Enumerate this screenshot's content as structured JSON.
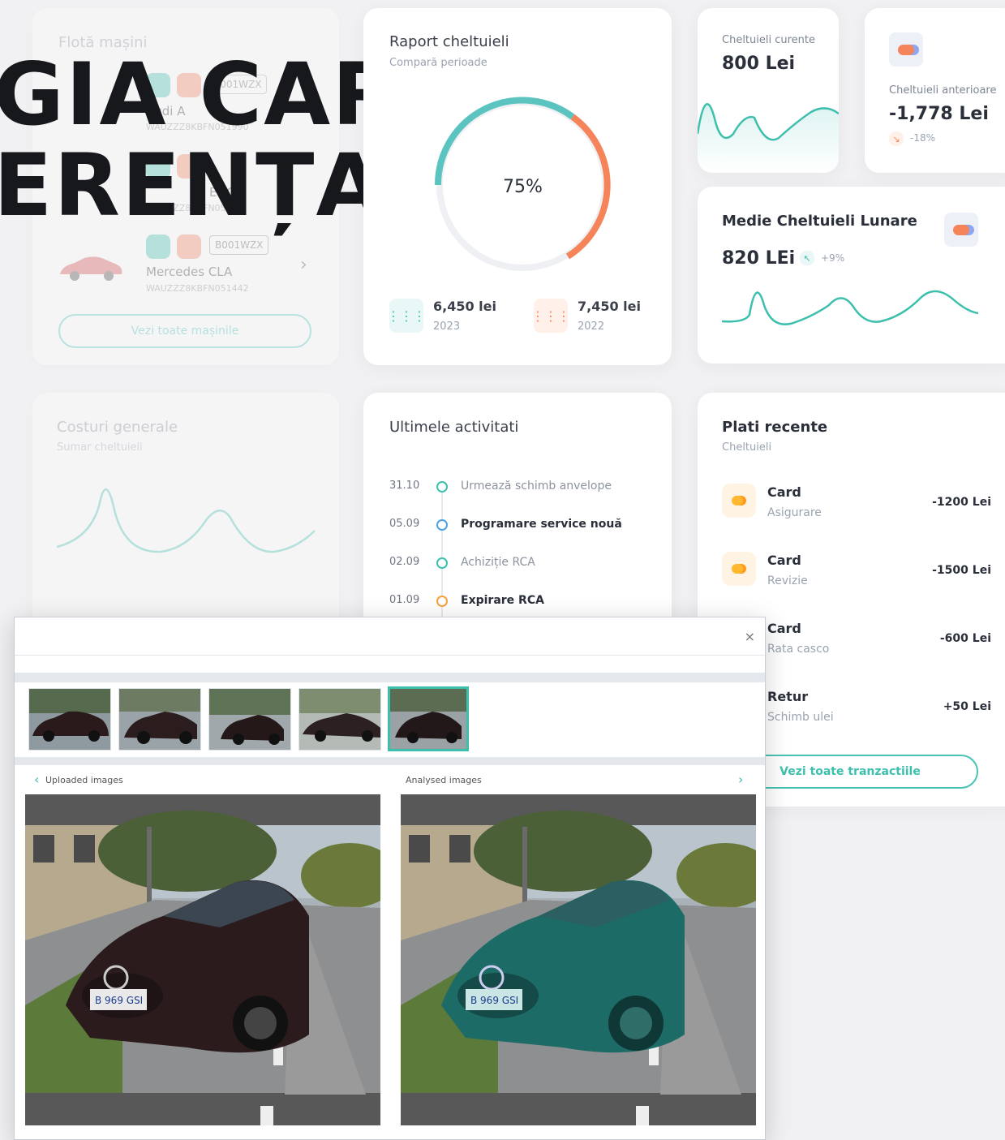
{
  "fleet": {
    "title": "Flotă mașini",
    "cars": [
      {
        "name": "Audi A",
        "vin": "WAUZZZ8KBFN051990",
        "plate": "B001WZX"
      },
      {
        "name": "EQC",
        "vin": "WAUZZZ8KBFN051",
        "plate": "B001WZX"
      },
      {
        "name": "Mercedes CLA",
        "vin": "WAUZZZ8KBFN051442",
        "plate": "B001WZX"
      }
    ],
    "button": "Vezi toate mașinile"
  },
  "headline": {
    "line1": "GIA CARE",
    "line2": "ERENȚA"
  },
  "report": {
    "title": "Raport cheltuieli",
    "subtitle": "Compară perioade",
    "percent": "75%",
    "current": {
      "value": "6,450 lei",
      "year": "2023"
    },
    "previous": {
      "value": "7,450 lei",
      "year": "2022"
    }
  },
  "current_expenses": {
    "label": "Cheltuieli curente",
    "value": "800 Lei"
  },
  "previous_expenses": {
    "label": "Cheltuieli anterioare",
    "value": "-1,778 Lei",
    "delta": "-18%"
  },
  "monthly_avg": {
    "title": "Medie Cheltuieli Lunare",
    "value": "820 LEi",
    "delta": "+9%"
  },
  "general_costs": {
    "title": "Costuri generale",
    "subtitle": "Sumar cheltuieli"
  },
  "activities": {
    "title": "Ultimele activitati",
    "items": [
      {
        "date": "31.10",
        "text": "Urmează schimb anvelope",
        "color": "#3dbfae",
        "bold": false
      },
      {
        "date": "05.09",
        "text": "Programare service nouă",
        "color": "#4aa3e8",
        "bold": true
      },
      {
        "date": "02.09",
        "text": "Achiziție RCA",
        "color": "#3dbfae",
        "bold": false
      },
      {
        "date": "01.09",
        "text": "Expirare RCA",
        "color": "#f5a33a",
        "bold": true
      }
    ]
  },
  "payments": {
    "title": "Plati recente",
    "subtitle": "Cheltuieli",
    "items": [
      {
        "name": "Card",
        "category": "Asigurare",
        "amount": "-1200 Lei"
      },
      {
        "name": "Card",
        "category": "Revizie",
        "amount": "-1500 Lei"
      },
      {
        "name": "Card",
        "category": "Rata casco",
        "amount": "-600 Lei"
      },
      {
        "name": "Retur",
        "category": "Schimb ulei",
        "amount": "+50 Lei"
      }
    ],
    "button": "Vezi toate tranzactiile"
  },
  "modal": {
    "close": "×",
    "uploaded_label": "Uploaded images",
    "analysed_label": "Analysed images",
    "prev": "‹",
    "next": "›",
    "plate": "B 969 GSI"
  },
  "colors": {
    "accent": "#3dbfae",
    "orange": "#f5845a",
    "text": "#2a2f3a"
  }
}
